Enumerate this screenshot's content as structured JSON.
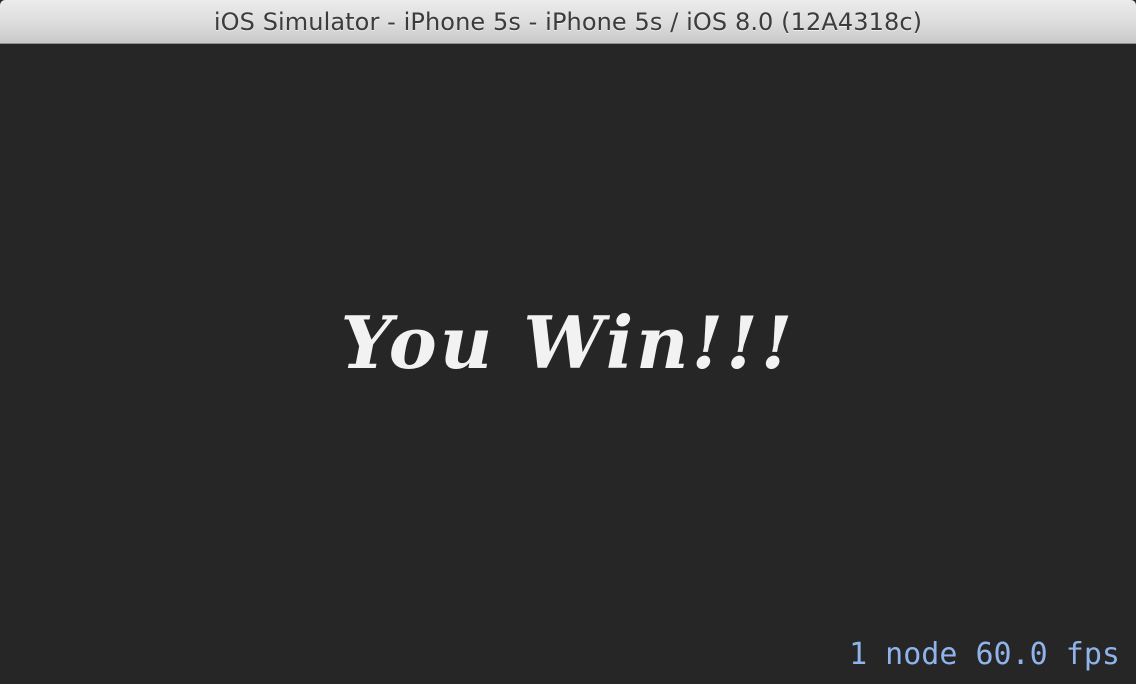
{
  "window": {
    "title": "iOS Simulator - iPhone 5s - iPhone 5s / iOS 8.0 (12A4318c)"
  },
  "scene": {
    "message": "You Win!!!",
    "stats": "1 node 60.0 fps"
  },
  "colors": {
    "background": "#262626",
    "message": "#f2f2f2",
    "stats": "#8fb3ea"
  }
}
